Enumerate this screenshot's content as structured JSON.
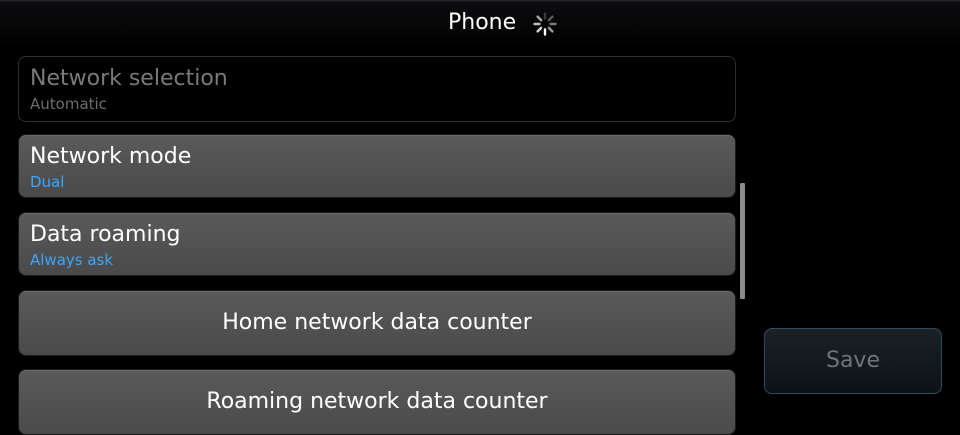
{
  "header": {
    "title": "Phone",
    "busy_icon": "loading-spinner-icon"
  },
  "settings": {
    "items": [
      {
        "label": "Network selection",
        "value": "Automatic",
        "enabled": false
      },
      {
        "label": "Network mode",
        "value": "Dual",
        "enabled": true
      },
      {
        "label": "Data roaming",
        "value": "Always ask",
        "enabled": true
      },
      {
        "label": "Home network data counter",
        "enabled": true
      },
      {
        "label": "Roaming network data counter",
        "enabled": true
      }
    ]
  },
  "actions": {
    "save_label": "Save",
    "save_enabled": false
  },
  "colors": {
    "background": "#000000",
    "value_accent": "#3aa6ff",
    "item_fill": "#505050",
    "disabled_text": "#7a7a7a"
  }
}
